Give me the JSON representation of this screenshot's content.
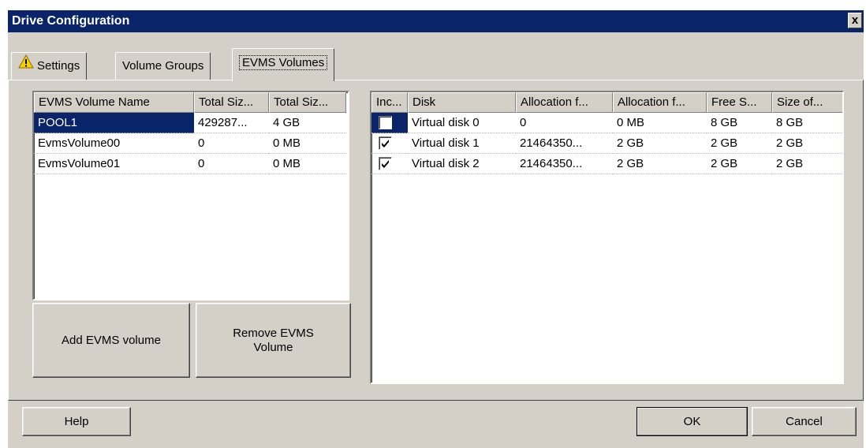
{
  "window": {
    "title": "Drive Configuration",
    "close_glyph": "x"
  },
  "tabs": [
    {
      "label": "Settings",
      "icon": "warning-icon"
    },
    {
      "label": "Volume Groups"
    },
    {
      "label": "EVMS Volumes",
      "active": true
    }
  ],
  "volumes_list": {
    "columns": [
      "EVMS Volume Name",
      "Total Siz...",
      "Total Siz..."
    ],
    "rows": [
      {
        "name": "POOL1",
        "size_bytes": "429287...",
        "size": "4 GB",
        "selected": true
      },
      {
        "name": "EvmsVolume00",
        "size_bytes": "0",
        "size": "0 MB"
      },
      {
        "name": "EvmsVolume01",
        "size_bytes": "0",
        "size": "0 MB"
      }
    ]
  },
  "disks_list": {
    "columns": [
      "Inc...",
      "Disk",
      "Allocation f...",
      "Allocation f...",
      "Free S...",
      "Size of..."
    ],
    "rows": [
      {
        "included": false,
        "disk": "Virtual disk 0",
        "alloc_bytes": "0",
        "alloc": "0 MB",
        "free": "8 GB",
        "size": "8 GB"
      },
      {
        "included": true,
        "disk": "Virtual disk 1",
        "alloc_bytes": "21464350...",
        "alloc": "2 GB",
        "free": "2 GB",
        "size": "2 GB"
      },
      {
        "included": true,
        "disk": "Virtual disk 2",
        "alloc_bytes": "21464350...",
        "alloc": "2 GB",
        "free": "2 GB",
        "size": "2 GB"
      }
    ]
  },
  "buttons": {
    "add": "Add EVMS volume",
    "remove": "Remove EVMS\nVolume",
    "help": "Help",
    "ok": "OK",
    "cancel": "Cancel"
  },
  "colors": {
    "title_bar": "#0a246a",
    "dialog_bg": "#d4d0c8",
    "selection": "#0a246a"
  }
}
